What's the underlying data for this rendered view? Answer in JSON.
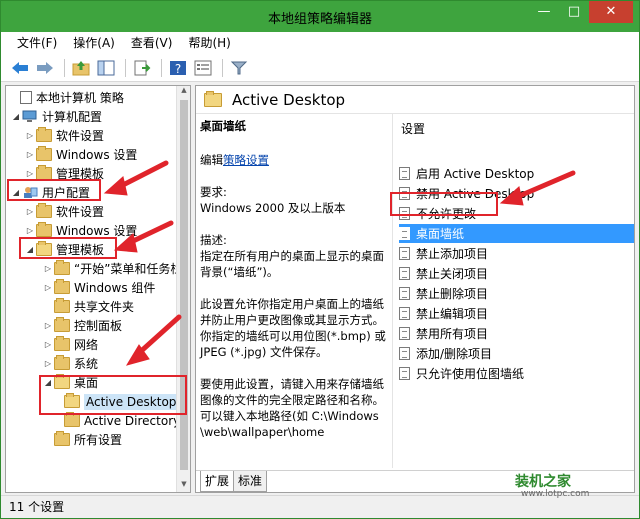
{
  "window": {
    "title": "本地组策略编辑器"
  },
  "menu": [
    "文件(F)",
    "操作(A)",
    "查看(V)",
    "帮助(H)"
  ],
  "toolbar": {
    "icons": [
      "back-icon",
      "forward-icon",
      "up-folder-icon",
      "show-hide-tree-icon",
      "export-icon",
      "help-icon",
      "properties-icon",
      "filter-icon"
    ]
  },
  "tree": {
    "root": "本地计算机 策略",
    "computer": "计算机配置",
    "computer_children": [
      "软件设置",
      "Windows 设置",
      "管理模板"
    ],
    "user": "用户配置",
    "user_children": [
      "软件设置",
      "Windows 设置",
      "管理模板"
    ],
    "admin_children": [
      "“开始”菜单和任务栏",
      "Windows 组件",
      "共享文件夹",
      "控制面板",
      "网络",
      "系统",
      "桌面"
    ],
    "desktop_children": [
      "Active Desktop",
      "Active Directory"
    ],
    "all_settings": "所有设置"
  },
  "header": {
    "title": "Active Desktop"
  },
  "description": {
    "heading": "桌面墙纸",
    "edit_prefix": "编辑",
    "edit_link": "策略设置",
    "req_label": "要求:",
    "req_value": "Windows 2000 及以上版本",
    "desc_label": "描述:",
    "desc_text": "指定在所有用户的桌面上显示的桌面背景(“墙纸”)。",
    "desc_text2": "此设置允许你指定用户桌面上的墙纸并防止用户更改图像或其显示方式。你指定的墙纸可以用位图(*.bmp) 或 JPEG (*.jpg) 文件保存。",
    "desc_text3": "要使用此设置，请键入用来存储墙纸图像的文件的完全限定路径和名称。可以键入本地路径(如 C:\\Windows\\web\\wallpaper\\home"
  },
  "list": {
    "header": "设置",
    "items": [
      "启用 Active Desktop",
      "禁用 Active Desktop",
      "不允许更改",
      "桌面墙纸",
      "禁止添加项目",
      "禁止关闭项目",
      "禁止删除项目",
      "禁止编辑项目",
      "禁用所有项目",
      "添加/删除项目",
      "只允许使用位图墙纸"
    ],
    "selected_index": 3
  },
  "tabs": [
    "扩展",
    "标准"
  ],
  "status": "11 个设置",
  "watermark": {
    "brand": "装机之家",
    "url": "www.lotpc.com"
  },
  "colors": {
    "accent": "#3ea43e",
    "annotation": "#e0242b",
    "selection": "#3399ff"
  }
}
